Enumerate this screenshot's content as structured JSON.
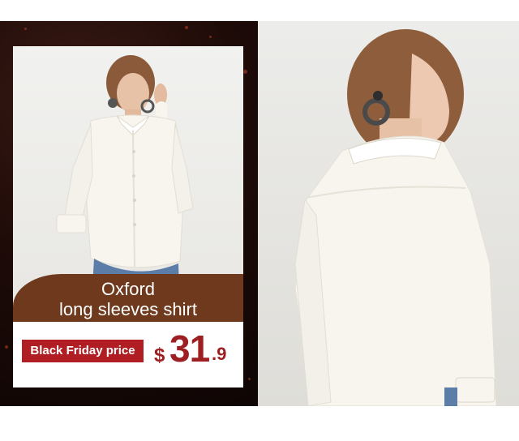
{
  "product": {
    "title_line1": "Oxford",
    "title_line2": "long sleeves shirt"
  },
  "promo": {
    "badge_label": "Black Friday price",
    "currency": "$",
    "price_integer": "31",
    "price_decimal": ".9"
  },
  "colors": {
    "dark_background": "#1e0b08",
    "title_band": "#6e391d",
    "badge": "#b01e23",
    "price": "#9e1f23",
    "shirt": "#f7f5ee"
  }
}
